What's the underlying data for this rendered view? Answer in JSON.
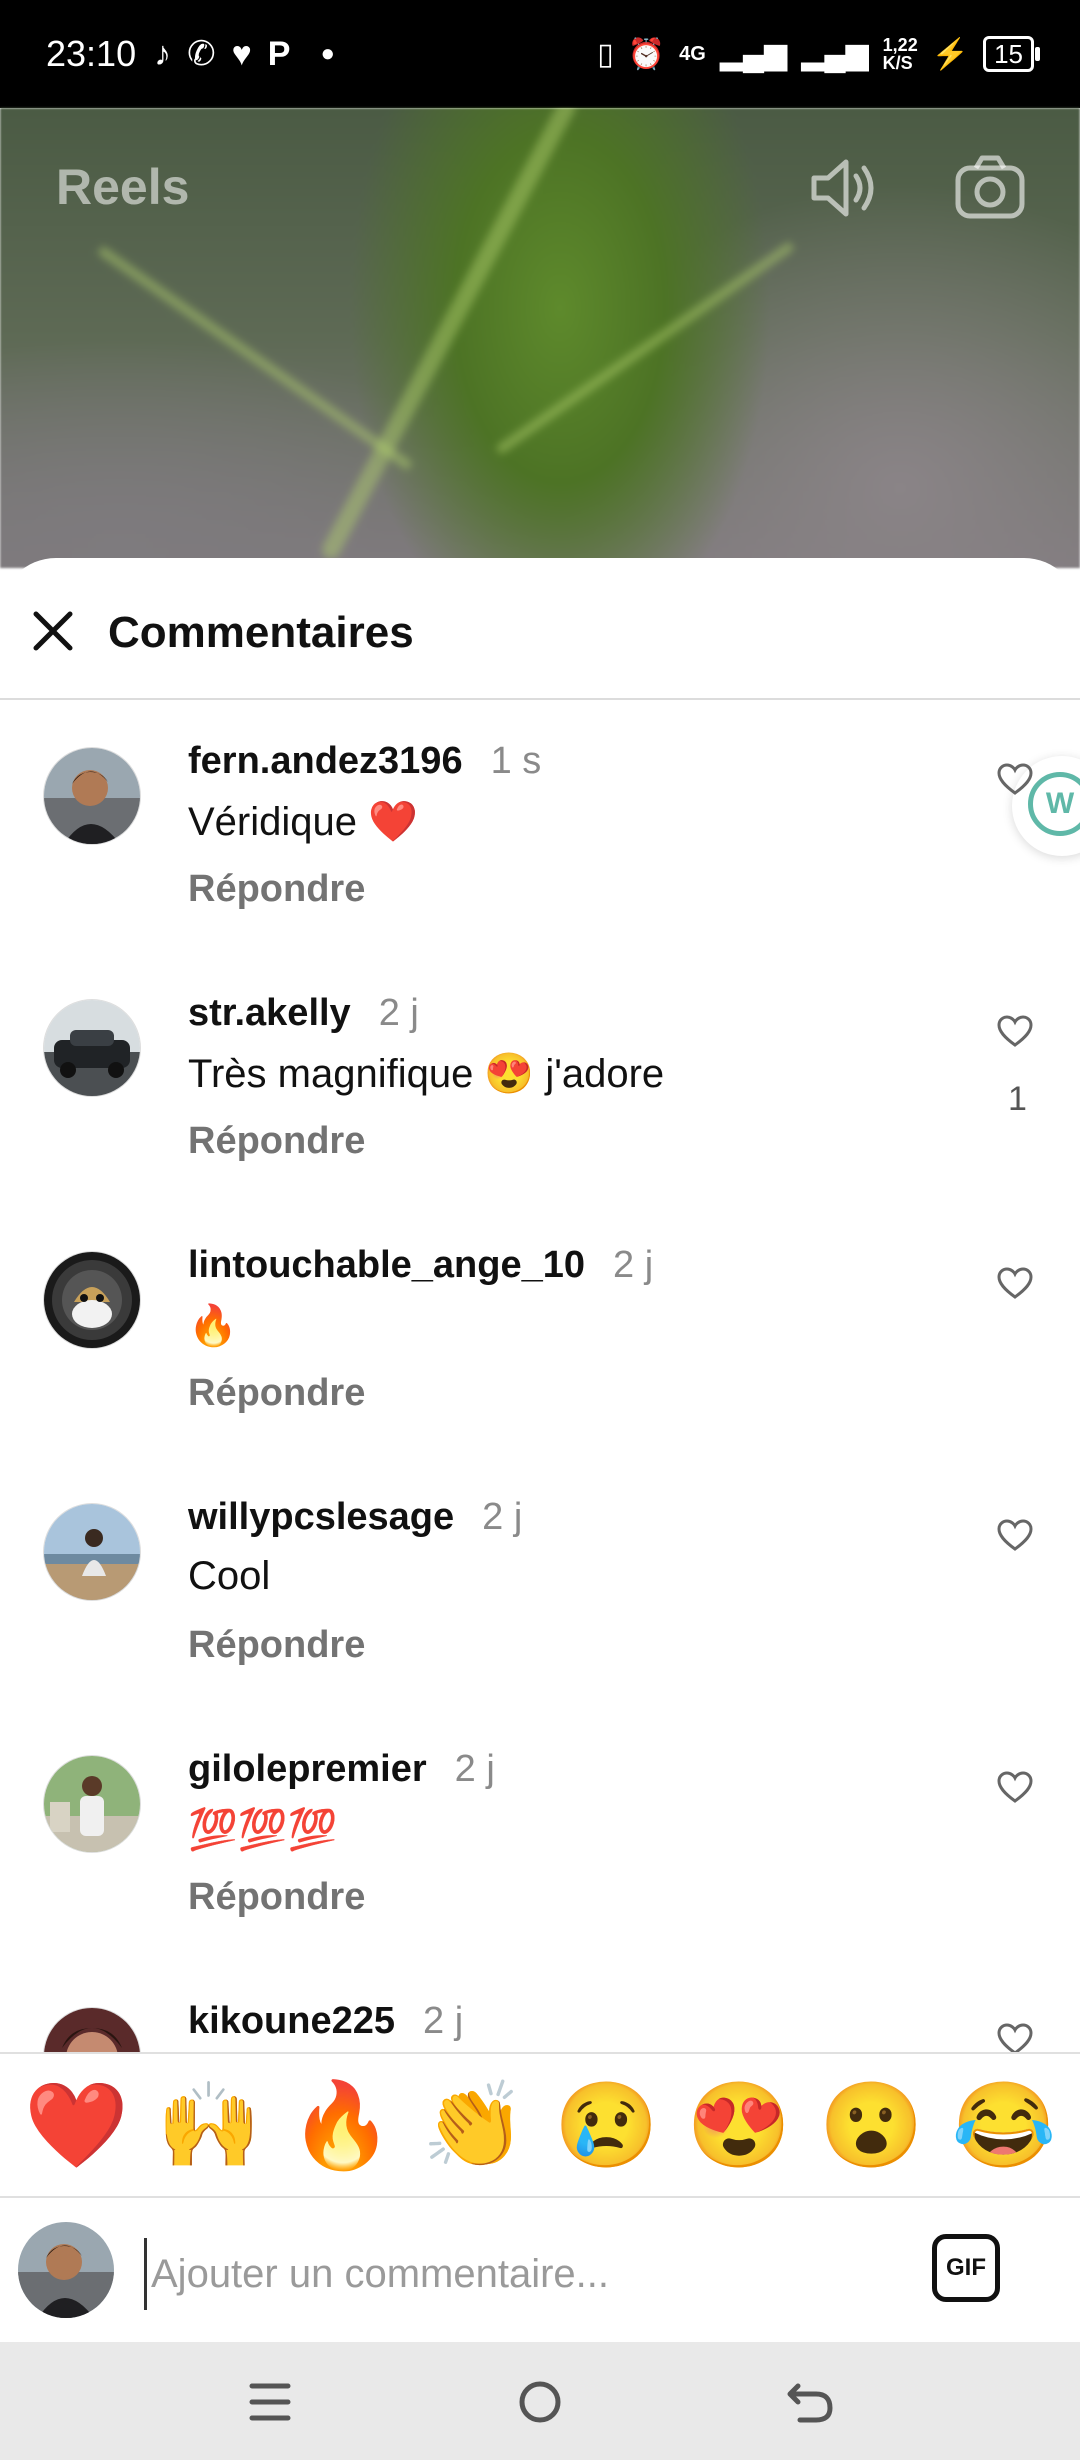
{
  "status_bar": {
    "time": "23:10",
    "icons_left": [
      "tiktok-icon",
      "whatsapp-icon",
      "heart-icon",
      "p-app-icon",
      "dot-icon"
    ],
    "network_label": "4G",
    "speed_value": "1,22",
    "speed_unit": "K/S",
    "battery": "15"
  },
  "reels": {
    "title": "Reels"
  },
  "sheet": {
    "title": "Commentaires"
  },
  "comments": [
    {
      "user": "fern.andez3196",
      "time": "1 s",
      "text": "Véridique ❤️",
      "reply": "Répondre",
      "likes": ""
    },
    {
      "user": "str.akelly",
      "time": "2 j",
      "text": "Très magnifique 😍 j'adore",
      "reply": "Répondre",
      "likes": "1"
    },
    {
      "user": "lintouchable_ange_10",
      "time": "2 j",
      "text": "🔥",
      "reply": "Répondre",
      "likes": ""
    },
    {
      "user": "willypcslesage",
      "time": "2 j",
      "text": "Cool",
      "reply": "Répondre",
      "likes": ""
    },
    {
      "user": "gilolepremier",
      "time": "2 j",
      "text": "💯💯💯",
      "reply": "Répondre",
      "likes": ""
    },
    {
      "user": "kikoune225",
      "time": "2 j",
      "text": "",
      "reply": "",
      "likes": ""
    }
  ],
  "floating_bubble": {
    "letter": "W"
  },
  "emoji_bar": [
    "❤️",
    "🙌",
    "🔥",
    "👏",
    "😢",
    "😍",
    "😮",
    "😂"
  ],
  "input": {
    "placeholder": "Ajouter un commentaire...",
    "gif_label": "GIF"
  },
  "colors": {
    "accent_bubble": "#5fb8a8",
    "secondary_text": "#737373"
  }
}
